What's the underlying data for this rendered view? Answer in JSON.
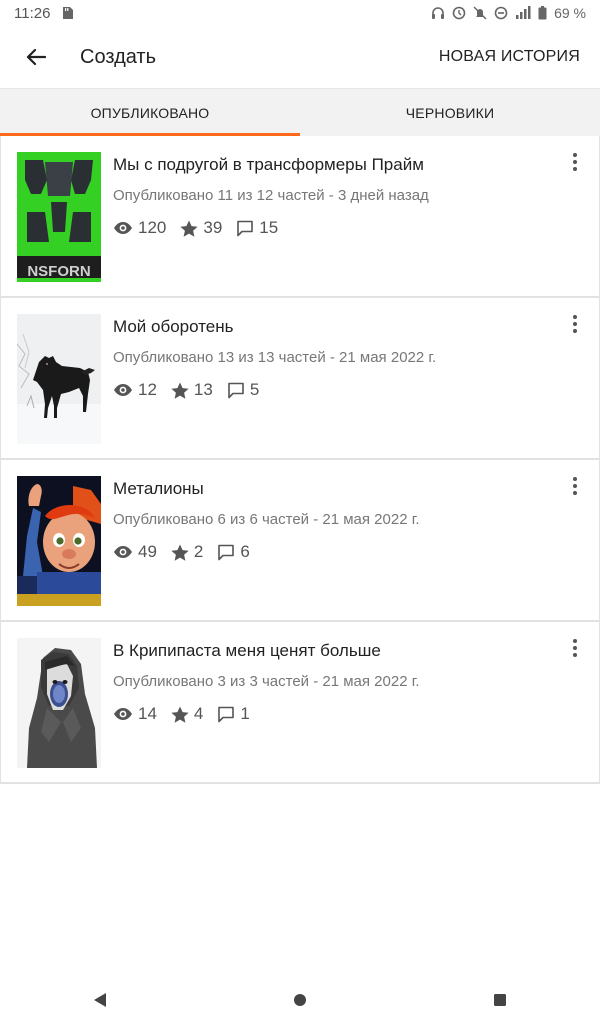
{
  "status_bar": {
    "time": "11:26",
    "battery": "69 %"
  },
  "app_bar": {
    "title": "Создать",
    "new_story": "НОВАЯ ИСТОРИЯ"
  },
  "tabs": [
    {
      "label": "ОПУБЛИКОВАНО",
      "active": true
    },
    {
      "label": "ЧЕРНОВИКИ",
      "active": false
    }
  ],
  "stories": [
    {
      "title": "Мы с подругой в трансформеры Прайм",
      "meta": "Опубликовано 11 из 12 частей - 3 дней назад",
      "views": "120",
      "votes": "39",
      "comments": "15",
      "cover": "transformers-logo-green"
    },
    {
      "title": "Мой оборотень",
      "meta": "Опубликовано 13 из 13 частей - 21 мая 2022 г.",
      "views": "12",
      "votes": "13",
      "comments": "5",
      "cover": "black-wolf-snow"
    },
    {
      "title": "Металионы",
      "meta": "Опубликовано 6 из 6 частей - 21 мая 2022 г.",
      "views": "49",
      "votes": "2",
      "comments": "6",
      "cover": "cartoon-character"
    },
    {
      "title": "В Крипипаста меня ценят больше",
      "meta": "Опубликовано 3 из 3 частей - 21 мая 2022 г.",
      "views": "14",
      "votes": "4",
      "comments": "1",
      "cover": "hooded-figure"
    }
  ],
  "icons": {
    "view": "eye-icon",
    "vote": "star-icon",
    "comment": "comment-icon",
    "more": "more-vert-icon"
  },
  "colors": {
    "accent": "#ff6a1a"
  }
}
